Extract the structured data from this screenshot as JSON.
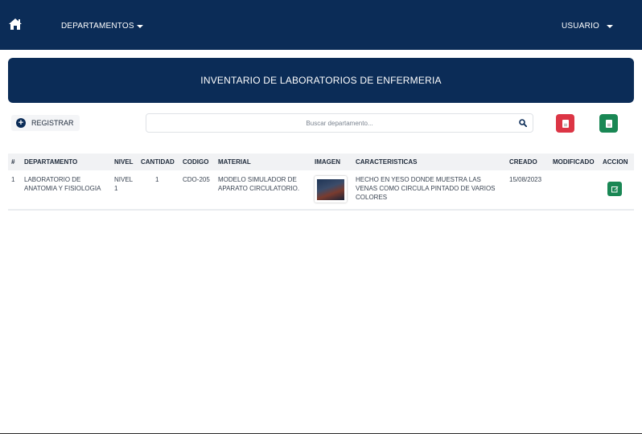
{
  "navbar": {
    "home_icon": "home-icon",
    "departments_label": "DEPARTAMENTOS",
    "user_label": "USUARIO",
    "background_color": "#0b2c57"
  },
  "banner": {
    "title": "INVENTARIO DE LABORATORIOS DE ENFERMERIA"
  },
  "toolbar": {
    "register_label": "REGISTRAR",
    "register_icon": "plus-circle-icon",
    "search_placeholder": "Buscar departamento...",
    "search_value": "",
    "pdf_icon": "file-pdf-icon",
    "pdf_color": "#dc3545",
    "excel_icon": "file-excel-icon",
    "excel_color": "#198754"
  },
  "table": {
    "headers": [
      "#",
      "DEPARTAMENTO",
      "NIVEL",
      "CANTIDAD",
      "CODIGO",
      "MATERIAL",
      "IMAGEN",
      "CARACTERISTICAS",
      "CREADO",
      "MODIFICADO",
      "ACCION"
    ],
    "rows": [
      {
        "num": "1",
        "departamento": "LABORATORIO DE ANATOMIA Y FISIOLOGIA",
        "nivel": "NIVEL 1",
        "cantidad": "1",
        "codigo": "CDO-205",
        "material": "MODELO SIMULADOR DE APARATO CIRCULATORIO.",
        "imagen": "thumbnail",
        "caracteristicas": "HECHO EN YESO DONDE MUESTRA LAS VENAS COMO CIRCULA PINTADO DE VARIOS COLORES",
        "creado": "15/08/2023",
        "modificado": "",
        "accion_icon": "edit-icon"
      }
    ]
  }
}
